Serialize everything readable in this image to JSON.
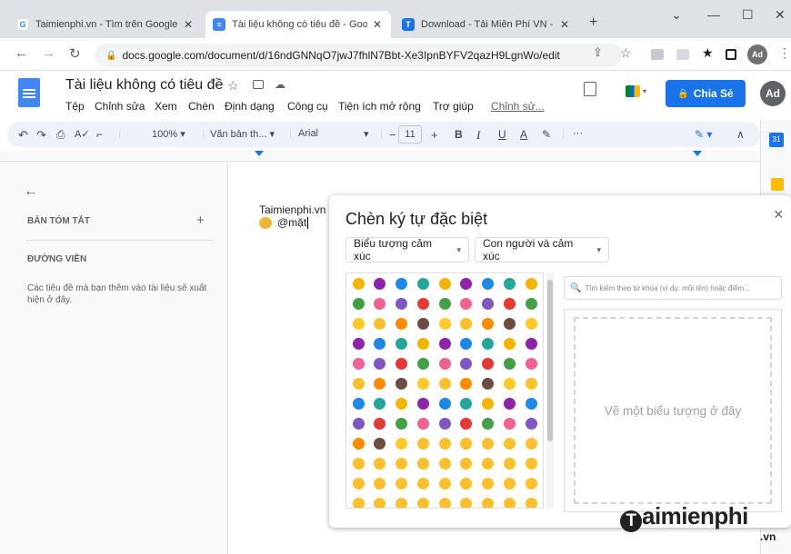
{
  "browser": {
    "tabs": [
      {
        "title": "Taimienphi.vn - Tìm trên Google",
        "favicon": "G",
        "favicon_color": "#4285f4",
        "active": false
      },
      {
        "title": "Tài liệu không có tiêu đề - Goog",
        "favicon": "≡",
        "favicon_color": "#4285f4",
        "active": true
      },
      {
        "title": "Download - Tải Miễn Phí VN - Ph",
        "favicon": "T",
        "favicon_color": "#1a73e8",
        "active": false
      }
    ],
    "new_tab": "+",
    "window_controls": [
      "⌄",
      "—",
      "☐",
      "✕"
    ],
    "url": "docs.google.com/document/d/16ndGNNqO7jwJ7fhlN7Bbt-Xe3IpnBYFV2qazH9LgnWo/edit",
    "profile": "Ad"
  },
  "docs": {
    "title": "Tài liệu không có tiêu đề",
    "menu": [
      "Tệp",
      "Chỉnh sửa",
      "Xem",
      "Chèn",
      "Định dạng",
      "Công cụ",
      "Tiện ích mở rộng",
      "Trợ giúp",
      "Chỉnh sử..."
    ],
    "share_label": "Chia Sẻ",
    "avatar": "Ad",
    "toolbar": {
      "zoom": "100%",
      "style": "Văn bản th...",
      "font": "Arial",
      "font_size": "11",
      "more": "···"
    }
  },
  "outline": {
    "summary_label": "BẢN TÓM TẮT",
    "add": "+",
    "headings_label": "ĐƯỜNG VIỀN",
    "hint": "Các tiêu đề mà bạn thêm vào tài liệu sẽ xuất hiện ở đây."
  },
  "document": {
    "line1": "Taimienphi.vn",
    "line2": "@mặt"
  },
  "dialog": {
    "title": "Chèn ký tự đặc biệt",
    "close": "×",
    "category": "Biểu tượng cảm xúc",
    "subcategory": "Con người và cảm xúc",
    "search_placeholder": "Tìm kiếm theo từ khóa (ví dụ: mũi tên) hoặc điểm...",
    "draw_hint": "Vẽ một biểu tượng ở đây"
  },
  "watermark": {
    "brand": "aimienphi",
    "suffix": ".vn"
  }
}
